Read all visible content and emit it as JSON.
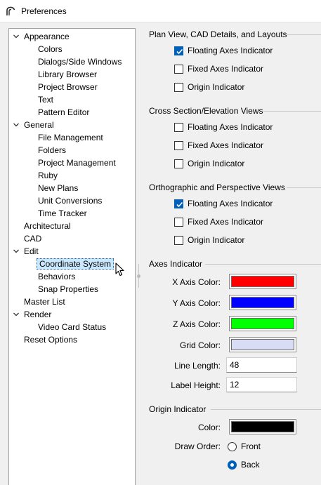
{
  "window": {
    "title": "Preferences",
    "icon": "chief-architect-logo-icon"
  },
  "tree": {
    "items": [
      {
        "label": "Appearance",
        "level": 0,
        "expanded": true
      },
      {
        "label": "Colors",
        "level": 1
      },
      {
        "label": "Dialogs/Side Windows",
        "level": 1
      },
      {
        "label": "Library Browser",
        "level": 1
      },
      {
        "label": "Project Browser",
        "level": 1
      },
      {
        "label": "Text",
        "level": 1
      },
      {
        "label": "Pattern Editor",
        "level": 1
      },
      {
        "label": "General",
        "level": 0,
        "expanded": true
      },
      {
        "label": "File Management",
        "level": 1
      },
      {
        "label": "Folders",
        "level": 1
      },
      {
        "label": "Project Management",
        "level": 1
      },
      {
        "label": "Ruby",
        "level": 1
      },
      {
        "label": "New Plans",
        "level": 1
      },
      {
        "label": "Unit Conversions",
        "level": 1
      },
      {
        "label": "Time Tracker",
        "level": 1
      },
      {
        "label": "Architectural",
        "level": 0
      },
      {
        "label": "CAD",
        "level": 0
      },
      {
        "label": "Edit",
        "level": 0,
        "expanded": true
      },
      {
        "label": "Coordinate System",
        "level": 1,
        "selected": true
      },
      {
        "label": "Behaviors",
        "level": 1
      },
      {
        "label": "Snap Properties",
        "level": 1
      },
      {
        "label": "Master List",
        "level": 0
      },
      {
        "label": "Render",
        "level": 0,
        "expanded": true
      },
      {
        "label": "Video Card Status",
        "level": 1
      },
      {
        "label": "Reset Options",
        "level": 0
      }
    ]
  },
  "plan_view": {
    "title": "Plan View, CAD Details, and Layouts",
    "floating_axes": {
      "label": "Floating Axes Indicator",
      "checked": true
    },
    "fixed_axes": {
      "label": "Fixed Axes Indicator",
      "checked": false
    },
    "origin": {
      "label": "Origin Indicator",
      "checked": false
    }
  },
  "cross_section": {
    "title": "Cross Section/Elevation Views",
    "floating_axes": {
      "label": "Floating Axes Indicator",
      "checked": false
    },
    "fixed_axes": {
      "label": "Fixed Axes Indicator",
      "checked": false
    },
    "origin": {
      "label": "Origin Indicator",
      "checked": false
    }
  },
  "ortho": {
    "title": "Orthographic and Perspective Views",
    "floating_axes": {
      "label": "Floating Axes Indicator",
      "checked": true
    },
    "fixed_axes": {
      "label": "Fixed Axes Indicator",
      "checked": false
    },
    "origin": {
      "label": "Origin Indicator",
      "checked": false
    }
  },
  "axes_indicator": {
    "title": "Axes Indicator",
    "x_color_label": "X Axis Color:",
    "x_color": "#ff0000",
    "y_color_label": "Y Axis Color:",
    "y_color": "#0000ff",
    "z_color_label": "Z Axis Color:",
    "z_color": "#00ff00",
    "grid_color_label": "Grid Color:",
    "grid_color": "#d9dcf5",
    "line_length_label": "Line Length:",
    "line_length": "48",
    "label_height_label": "Label Height:",
    "label_height": "12"
  },
  "origin_indicator": {
    "title": "Origin Indicator",
    "color_label": "Color:",
    "color": "#000000",
    "draw_order_label": "Draw Order:",
    "front_label": "Front",
    "back_label": "Back",
    "draw_order": "Back"
  },
  "theme": {
    "accent": "#005fb8",
    "selection_bg": "#cce8ff"
  }
}
